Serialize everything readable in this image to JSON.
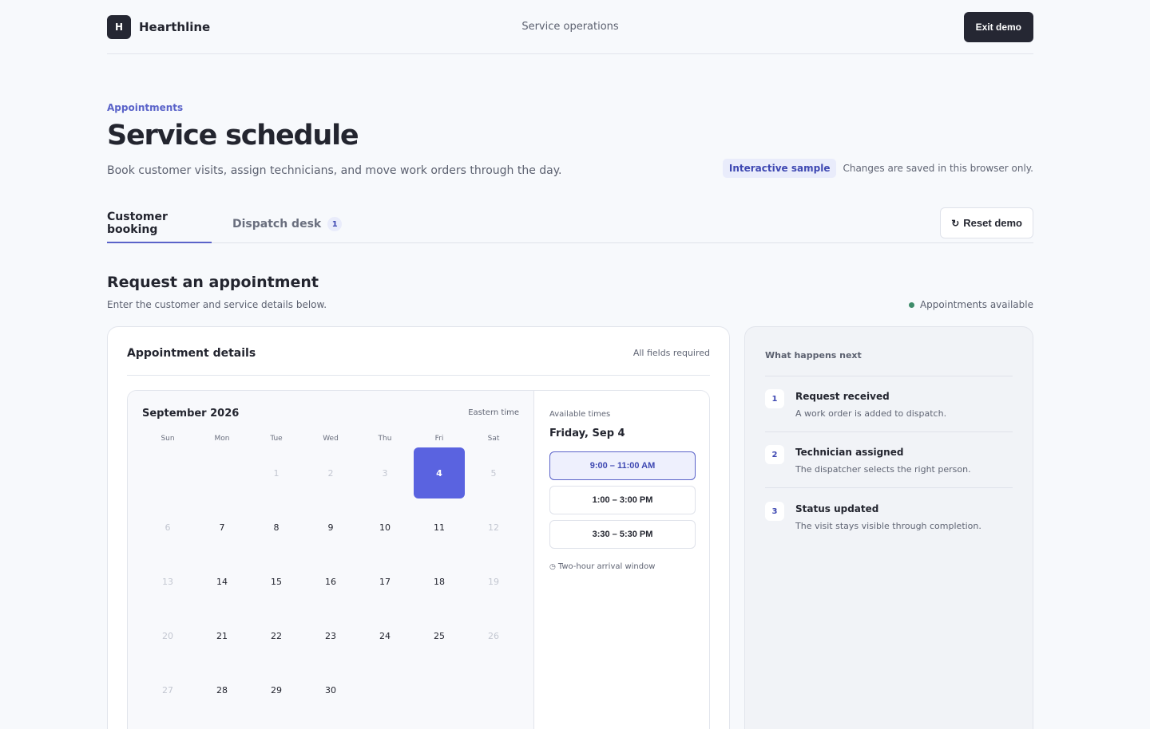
{
  "header": {
    "logo_letter": "H",
    "brand": "Hearthline",
    "center_title": "Service operations",
    "exit_label": "Exit demo"
  },
  "page": {
    "eyebrow": "Appointments",
    "title": "Service schedule",
    "subtitle": "Book customer visits, assign technicians, and move work orders through the day.",
    "sample_badge": "Interactive sample",
    "sample_note": "Changes are saved in this browser only."
  },
  "tabs": [
    {
      "label": "Customer booking",
      "active": true
    },
    {
      "label": "Dispatch desk",
      "active": false,
      "count": "1"
    }
  ],
  "reset": {
    "icon": "refresh-icon",
    "label": "Reset demo"
  },
  "section": {
    "title": "Request an appointment",
    "subtitle": "Enter the customer and service details below.",
    "availability": "Appointments available"
  },
  "card": {
    "title": "Appointment details",
    "required_note": "All fields required"
  },
  "calendar": {
    "month": "September 2026",
    "timezone": "Eastern time",
    "weekdays": [
      "Sun",
      "Mon",
      "Tue",
      "Wed",
      "Thu",
      "Fri",
      "Sat"
    ],
    "weeks": [
      [
        null,
        null,
        "1",
        "2",
        "3",
        "4",
        "5"
      ],
      [
        "6",
        "7",
        "8",
        "9",
        "10",
        "11",
        "12"
      ],
      [
        "13",
        "14",
        "15",
        "16",
        "17",
        "18",
        "19"
      ],
      [
        "20",
        "21",
        "22",
        "23",
        "24",
        "25",
        "26"
      ],
      [
        "27",
        "28",
        "29",
        "30",
        null,
        null,
        null
      ]
    ],
    "disabled_days": [
      "1",
      "2",
      "3",
      "5",
      "6",
      "12",
      "13",
      "19",
      "20",
      "26",
      "27"
    ],
    "selected_day": "4"
  },
  "times": {
    "label": "Available times",
    "date": "Friday, Sep 4",
    "slots": [
      {
        "label": "9:00 – 11:00 AM",
        "selected": true
      },
      {
        "label": "1:00 – 3:00 PM",
        "selected": false
      },
      {
        "label": "3:30 – 5:30 PM",
        "selected": false
      }
    ],
    "note_icon": "clock-icon",
    "note": "Two-hour arrival window"
  },
  "next_steps": {
    "title": "What happens next",
    "steps": [
      {
        "number": "1",
        "title": "Request received",
        "description": "A work order is added to dispatch."
      },
      {
        "number": "2",
        "title": "Technician assigned",
        "description": "The dispatcher selects the right person."
      },
      {
        "number": "3",
        "title": "Status updated",
        "description": "The visit stays visible through completion."
      }
    ]
  },
  "colors": {
    "accent": "#5a63e0",
    "accent_text": "#3e48b2",
    "dark": "#252733",
    "available_dot": "#3e8c6a"
  }
}
